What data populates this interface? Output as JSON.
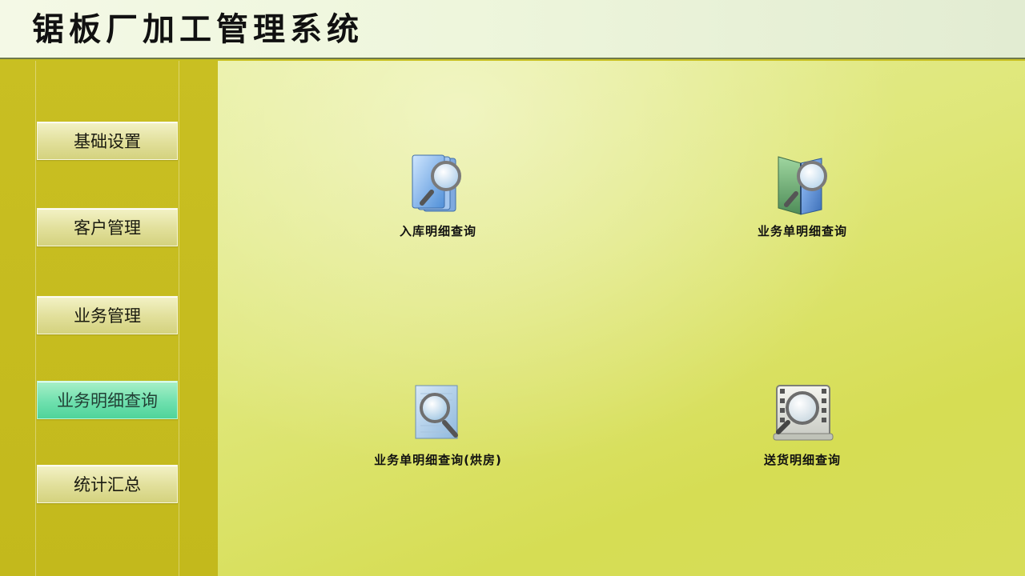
{
  "header": {
    "title": "锯板厂加工管理系统"
  },
  "sidebar": {
    "items": [
      {
        "label": "基础设置"
      },
      {
        "label": "客户管理"
      },
      {
        "label": "业务管理"
      },
      {
        "label": "业务明细查询"
      },
      {
        "label": "统计汇总"
      }
    ],
    "active_index": 3
  },
  "main": {
    "tiles": [
      {
        "label": "入库明细查询",
        "icon": "stacked-docs-magnifier-icon"
      },
      {
        "label": "业务单明细查询",
        "icon": "folder-magnifier-icon"
      },
      {
        "label": "业务单明细查询(烘房)",
        "icon": "document-magnifier-icon"
      },
      {
        "label": "送货明细查询",
        "icon": "film-magnifier-icon"
      }
    ]
  },
  "colors": {
    "sidebar_bg": "#c6bc1f",
    "main_bg": "#dde36e",
    "active_tab": "#6fe0ae",
    "header_bg": "#eef6dc"
  }
}
